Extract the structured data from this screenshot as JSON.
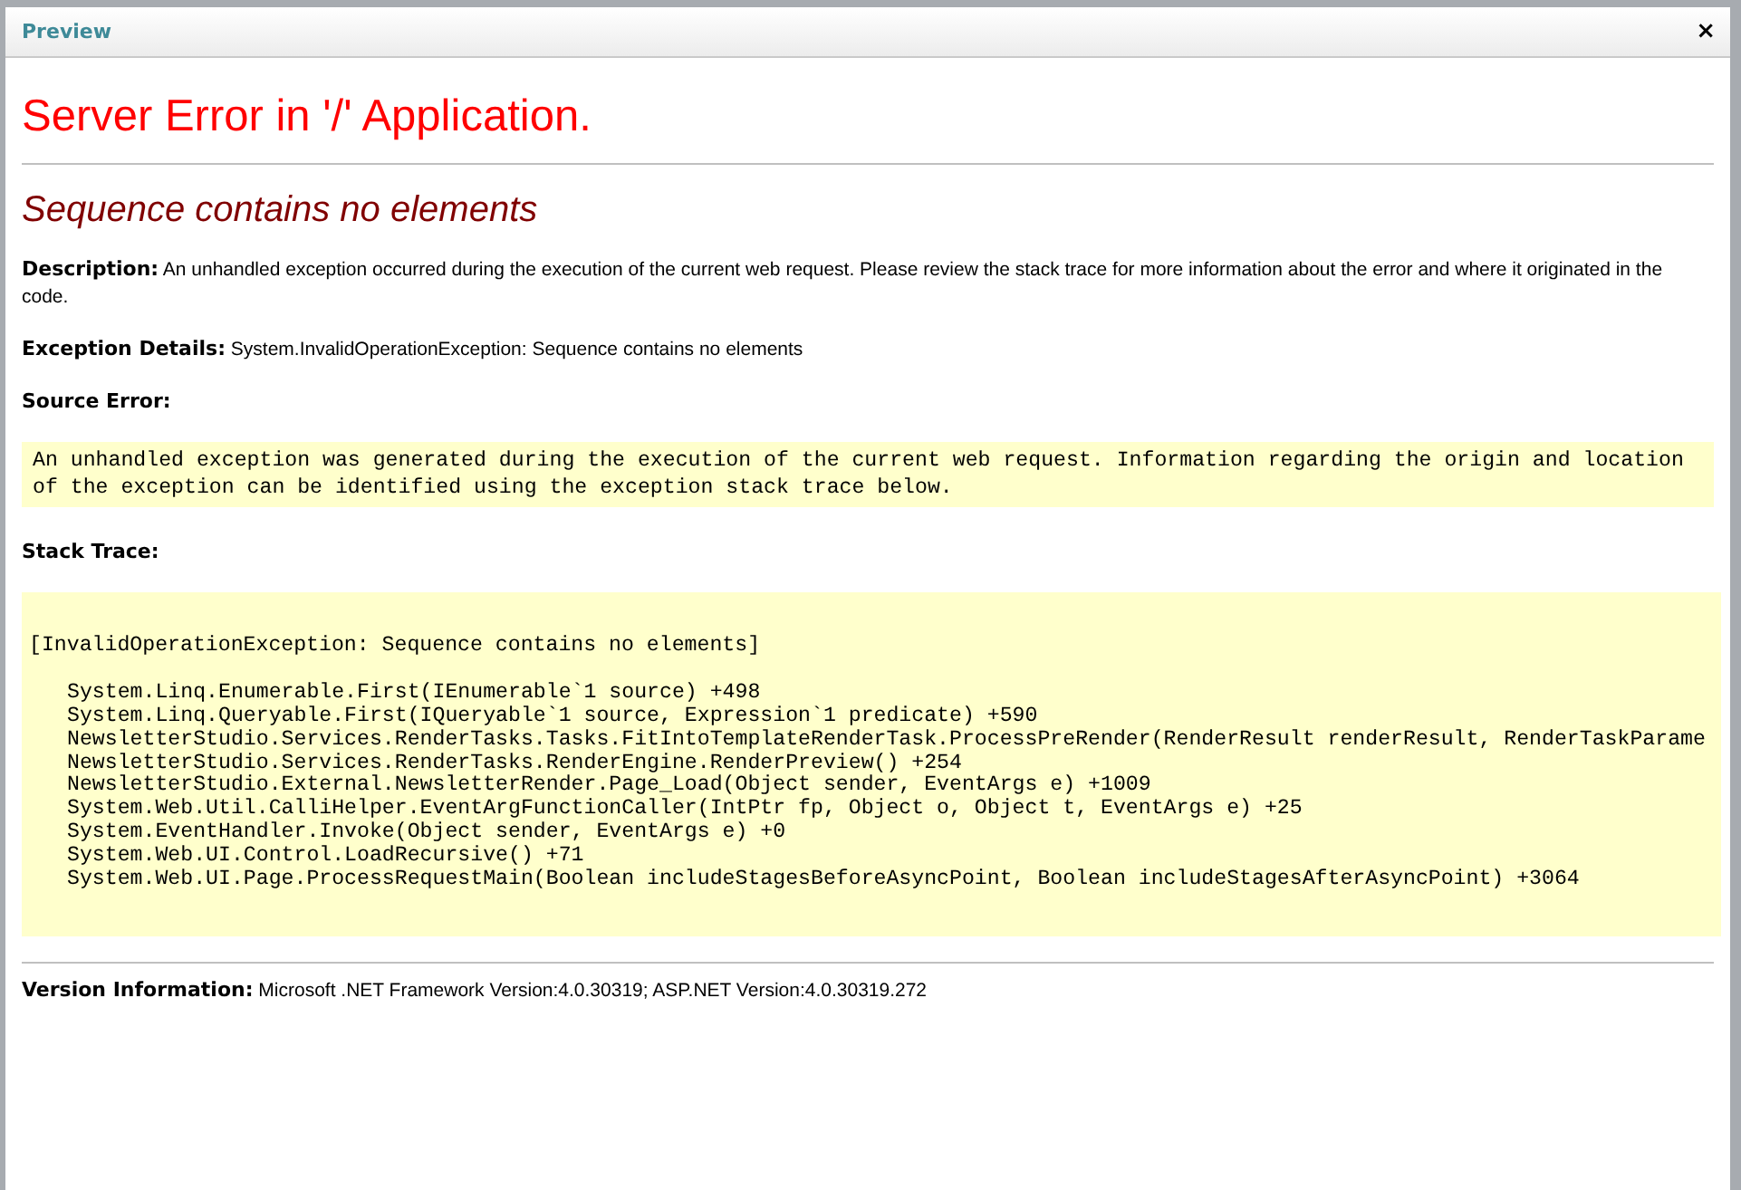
{
  "window": {
    "title": "Preview",
    "close": "×"
  },
  "page": {
    "title": "Server Error in '/' Application.",
    "error_message": "Sequence contains no elements",
    "description": {
      "label": "Description:",
      "text": "An unhandled exception occurred during the execution of the current web request. Please review the stack trace for more information about the error and where it originated in the code."
    },
    "exception_details": {
      "label": "Exception Details:",
      "text": "System.InvalidOperationException: Sequence contains no elements"
    },
    "source_error": {
      "label": "Source Error:",
      "text": "An unhandled exception was generated during the execution of the current web request. Information regarding the origin and location of the exception can be identified using the exception stack trace below."
    },
    "stack_trace": {
      "label": "Stack Trace:",
      "exception_line": "[InvalidOperationException: Sequence contains no elements]",
      "frames": [
        "System.Linq.Enumerable.First(IEnumerable`1 source) +498",
        "System.Linq.Queryable.First(IQueryable`1 source, Expression`1 predicate) +590",
        "NewsletterStudio.Services.RenderTasks.Tasks.FitIntoTemplateRenderTask.ProcessPreRender(RenderResult renderResult, RenderTaskParame",
        "NewsletterStudio.Services.RenderTasks.RenderEngine.RenderPreview() +254",
        "NewsletterStudio.External.NewsletterRender.Page_Load(Object sender, EventArgs e) +1009",
        "System.Web.Util.CalliHelper.EventArgFunctionCaller(IntPtr fp, Object o, Object t, EventArgs e) +25",
        "System.EventHandler.Invoke(Object sender, EventArgs e) +0",
        "System.Web.UI.Control.LoadRecursive() +71",
        "System.Web.UI.Page.ProcessRequestMain(Boolean includeStagesBeforeAsyncPoint, Boolean includeStagesAfterAsyncPoint) +3064"
      ]
    },
    "version_info": {
      "label": "Version Information:",
      "text": "Microsoft .NET Framework Version:4.0.30319; ASP.NET Version:4.0.30319.272"
    }
  }
}
